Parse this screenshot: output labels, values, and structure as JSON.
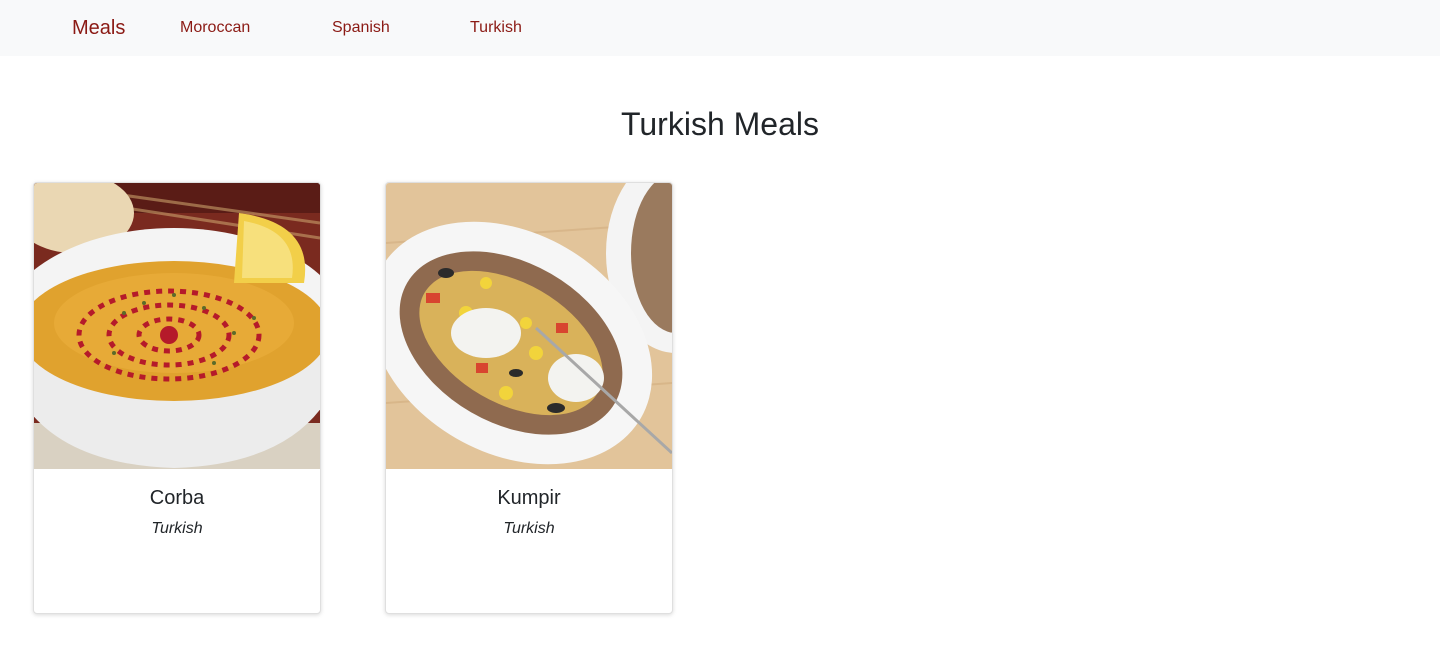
{
  "navbar": {
    "brand": "Meals",
    "links": [
      "Moroccan",
      "Spanish",
      "Turkish"
    ],
    "link_color": "#8b1a14",
    "background": "#f8f9fa"
  },
  "page": {
    "title": "Turkish Meals"
  },
  "meals": [
    {
      "name": "Corba",
      "cuisine": "Turkish",
      "image": "lentil-soup-photo"
    },
    {
      "name": "Kumpir",
      "cuisine": "Turkish",
      "image": "stuffed-baked-potato-photo"
    }
  ]
}
